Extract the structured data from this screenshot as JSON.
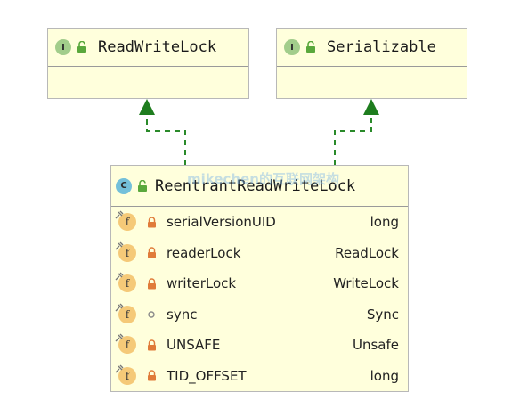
{
  "interfaces": [
    {
      "name": "ReadWriteLock",
      "badge": "I"
    },
    {
      "name": "Serializable",
      "badge": "I"
    }
  ],
  "class": {
    "name": "ReentrantReadWriteLock",
    "badge": "C",
    "fields": [
      {
        "name": "serialVersionUID",
        "type": "long",
        "visibility": "private",
        "badge": "f"
      },
      {
        "name": "readerLock",
        "type": "ReadLock",
        "visibility": "private",
        "badge": "f"
      },
      {
        "name": "writerLock",
        "type": "WriteLock",
        "visibility": "private",
        "badge": "f"
      },
      {
        "name": "sync",
        "type": "Sync",
        "visibility": "package",
        "badge": "f"
      },
      {
        "name": "UNSAFE",
        "type": "Unsafe",
        "visibility": "private",
        "badge": "f"
      },
      {
        "name": "TID_OFFSET",
        "type": "long",
        "visibility": "private",
        "badge": "f"
      }
    ]
  },
  "watermark": "mikechen的互联网架构",
  "colors": {
    "box_fill": "#ffffdc",
    "edge": "#2a8a2a",
    "arrowhead": "#1e7d1e",
    "interface_badge": "#a2cd8b",
    "class_badge": "#74c0da",
    "field_badge": "#f5c978",
    "private_lock": "#e07b39"
  }
}
